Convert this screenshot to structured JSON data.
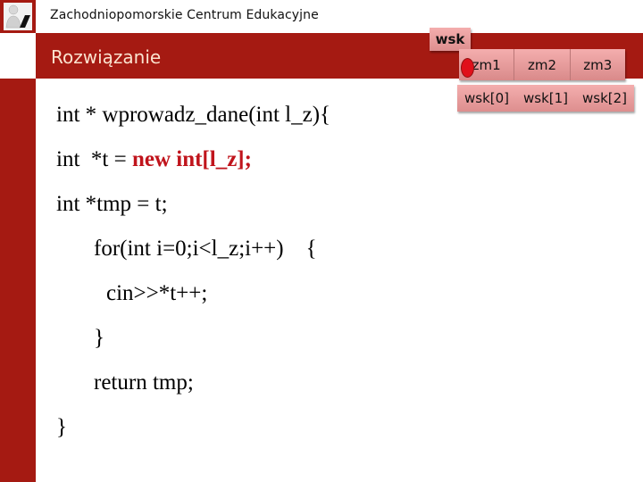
{
  "header": {
    "organization": "Zachodniopomorskie Centrum Edukacyjne",
    "slide_title": "Rozwiązanie",
    "logo_icon": "person-at-laptop-icon"
  },
  "code": {
    "line1": "int * wprowadz_dane(int l_z){",
    "line2_plain": "int  *t = ",
    "line2_highlight": "new int[l_z];",
    "line3": "int *tmp = t;",
    "line4": "for(int i=0;i<l_z;i++)    {",
    "line5": "cin>>*t++;",
    "line6": "}",
    "line7": "return tmp;",
    "line8": "}"
  },
  "diagram": {
    "pointer_label": "wsk",
    "cells": [
      "zm1",
      "zm2",
      "zm3"
    ],
    "indices": [
      "wsk[0]",
      "wsk[1]",
      "wsk[2]"
    ],
    "marker_color": "#e0101a"
  },
  "colors": {
    "brand_red": "#a51a12",
    "box_pink": "#f4aeae",
    "highlight_red": "#c0141c"
  }
}
